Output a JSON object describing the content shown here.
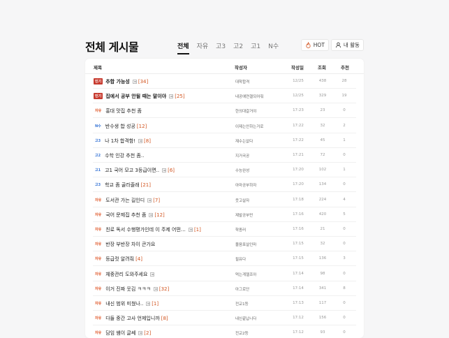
{
  "page": {
    "title": "전체 게시물"
  },
  "tabs": [
    {
      "label": "전체",
      "active": true
    },
    {
      "label": "자유",
      "active": false
    },
    {
      "label": "고3",
      "active": false
    },
    {
      "label": "고2",
      "active": false
    },
    {
      "label": "고1",
      "active": false
    },
    {
      "label": "N수",
      "active": false
    }
  ],
  "actions": {
    "hot_label": "HOT",
    "my_label": "내 활동"
  },
  "columns": {
    "title": "제목",
    "author": "작성자",
    "date": "작성일",
    "views": "조회",
    "likes": "추천"
  },
  "posts": [
    {
      "badge": "인기",
      "badge_type": "hot",
      "title": "추합 가능성",
      "bold": true,
      "image": true,
      "comments": "[34]",
      "author": "대학합격",
      "date": "12/25",
      "views": "438",
      "likes": "28"
    },
    {
      "badge": "인기",
      "badge_type": "hot",
      "title": "집에서 공부 안될 때는 말이야",
      "bold": true,
      "image": true,
      "comments": "[25]",
      "author": "내공에연결되어줘",
      "date": "12/25",
      "views": "329",
      "likes": "19"
    },
    {
      "badge": "자유",
      "badge_type": "free",
      "title": "홍대 맛집 추천 좀",
      "bold": false,
      "image": false,
      "comments": "",
      "author": "한의대갈거야",
      "date": "17:23",
      "views": "23",
      "likes": "0"
    },
    {
      "badge": "N수",
      "badge_type": "n",
      "title": "반수생 합 성공",
      "bold": false,
      "image": false,
      "comments": "[12]",
      "author": "이제는안하는거로",
      "date": "17:22",
      "views": "32",
      "likes": "2"
    },
    {
      "badge": "고3",
      "badge_type": "g3",
      "title": "나 1차 합격함!",
      "bold": false,
      "image": true,
      "comments": "[8]",
      "author": "재수는없다",
      "date": "17:22",
      "views": "45",
      "likes": "1"
    },
    {
      "badge": "고2",
      "badge_type": "g2",
      "title": "수학 인강 추천 좀..",
      "bold": false,
      "image": false,
      "comments": "",
      "author": "지거국공",
      "date": "17:21",
      "views": "72",
      "likes": "0"
    },
    {
      "badge": "고1",
      "badge_type": "g1",
      "title": "고1 국어 모고 3등급이면..",
      "bold": false,
      "image": true,
      "comments": "[6]",
      "author": "수능완성",
      "date": "17:20",
      "views": "102",
      "likes": "1"
    },
    {
      "badge": "고3",
      "badge_type": "g3",
      "title": "학교 좀 골라줄래",
      "bold": false,
      "image": false,
      "comments": "[21]",
      "author": "아마공부하자",
      "date": "17:20",
      "views": "134",
      "likes": "0"
    },
    {
      "badge": "자유",
      "badge_type": "free",
      "title": "도서관 가는 길인디",
      "bold": false,
      "image": true,
      "comments": "[7]",
      "author": "웃고살자",
      "date": "17:18",
      "views": "224",
      "likes": "4"
    },
    {
      "badge": "자유",
      "badge_type": "free",
      "title": "국어 문제집 추천 좀",
      "bold": false,
      "image": true,
      "comments": "[12]",
      "author": "제발공부만",
      "date": "17:16",
      "views": "420",
      "likes": "5"
    },
    {
      "badge": "자유",
      "badge_type": "free",
      "title": "친로 독서 수행평가인데 이 주제 어떤…",
      "bold": false,
      "image": true,
      "comments": "[1]",
      "author": "학종러",
      "date": "17:16",
      "views": "21",
      "likes": "0"
    },
    {
      "badge": "자유",
      "badge_type": "free",
      "title": "반장 부반장 차이 큰가요",
      "bold": false,
      "image": false,
      "comments": "",
      "author": "몰음표살인마",
      "date": "17:15",
      "views": "32",
      "likes": "0"
    },
    {
      "badge": "자유",
      "badge_type": "free",
      "title": "등급컷 알려줘",
      "bold": false,
      "image": false,
      "comments": "[4]",
      "author": "필유다",
      "date": "17:15",
      "views": "136",
      "likes": "3"
    },
    {
      "badge": "자유",
      "badge_type": "free",
      "title": "체중관리 도와주세요",
      "bold": false,
      "image": true,
      "comments": "",
      "author": "먹는게젤조아",
      "date": "17:14",
      "views": "98",
      "likes": "0"
    },
    {
      "badge": "자유",
      "badge_type": "free",
      "title": "이거 진짜 웃김 ㅋㅋㅋ",
      "bold": false,
      "image": true,
      "comments": "[32]",
      "author": "아그로단",
      "date": "17:14",
      "views": "341",
      "likes": "8"
    },
    {
      "badge": "자유",
      "badge_type": "free",
      "title": "내신 범위 미쳤나..",
      "bold": false,
      "image": true,
      "comments": "[1]",
      "author": "전교1등",
      "date": "17:13",
      "views": "117",
      "likes": "0"
    },
    {
      "badge": "자유",
      "badge_type": "free",
      "title": "다들 중간 고사 언제입니까",
      "bold": false,
      "image": false,
      "comments": "[8]",
      "author": "내신끝납니다",
      "date": "17:12",
      "views": "156",
      "likes": "0"
    },
    {
      "badge": "자유",
      "badge_type": "free",
      "title": "담임 쌤이 글쎄",
      "bold": false,
      "image": true,
      "comments": "[2]",
      "author": "전교2등",
      "date": "17:12",
      "views": "93",
      "likes": "0"
    }
  ]
}
